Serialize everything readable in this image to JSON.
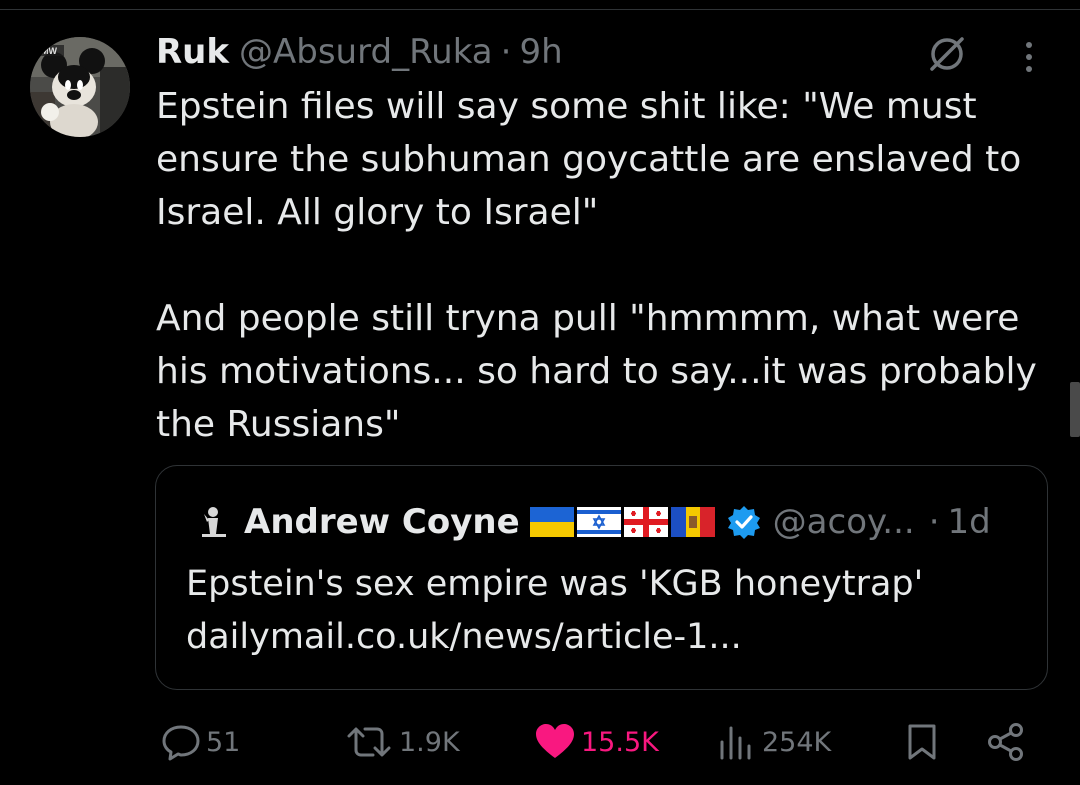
{
  "tweet": {
    "author": {
      "display_name": "Ruk",
      "handle": "@Absurd_Ruka",
      "separator": "·",
      "time": "9h",
      "avatar_badge": "MW"
    },
    "text_lines": [
      "Epstein files will say some shit like: \"We must",
      "ensure the subhuman goycattle are enslaved to",
      "Israel. All glory to Israel\"",
      "And people still tryna pull  \"hmmmm, what were",
      "his motivations... so hard to say...it was probably",
      "the Russians\""
    ],
    "header_icons": [
      "grok-icon",
      "more-vertical-icon"
    ]
  },
  "quote": {
    "author": {
      "display_name": "Andrew Coyne",
      "flags": [
        "ukraine-flag",
        "israel-flag",
        "georgia-flag",
        "moldova-flag"
      ],
      "verified_icon": "verified-badge-icon",
      "handle": "@acoy...",
      "separator": "·",
      "time": "1d"
    },
    "text_lines": [
      "Epstein's sex empire was 'KGB honeytrap'",
      "dailymail.co.uk/news/article-1..."
    ]
  },
  "actions": {
    "reply_count": "51",
    "retweet_count": "1.9K",
    "like_count": "15.5K",
    "views_count": "254K",
    "liked": true
  },
  "colors": {
    "background": "#000000",
    "text_primary": "#e7e9ea",
    "text_secondary": "#71767b",
    "border": "#2f3336",
    "like_pink": "#f91880",
    "verified_blue": "#1d9bf0"
  }
}
